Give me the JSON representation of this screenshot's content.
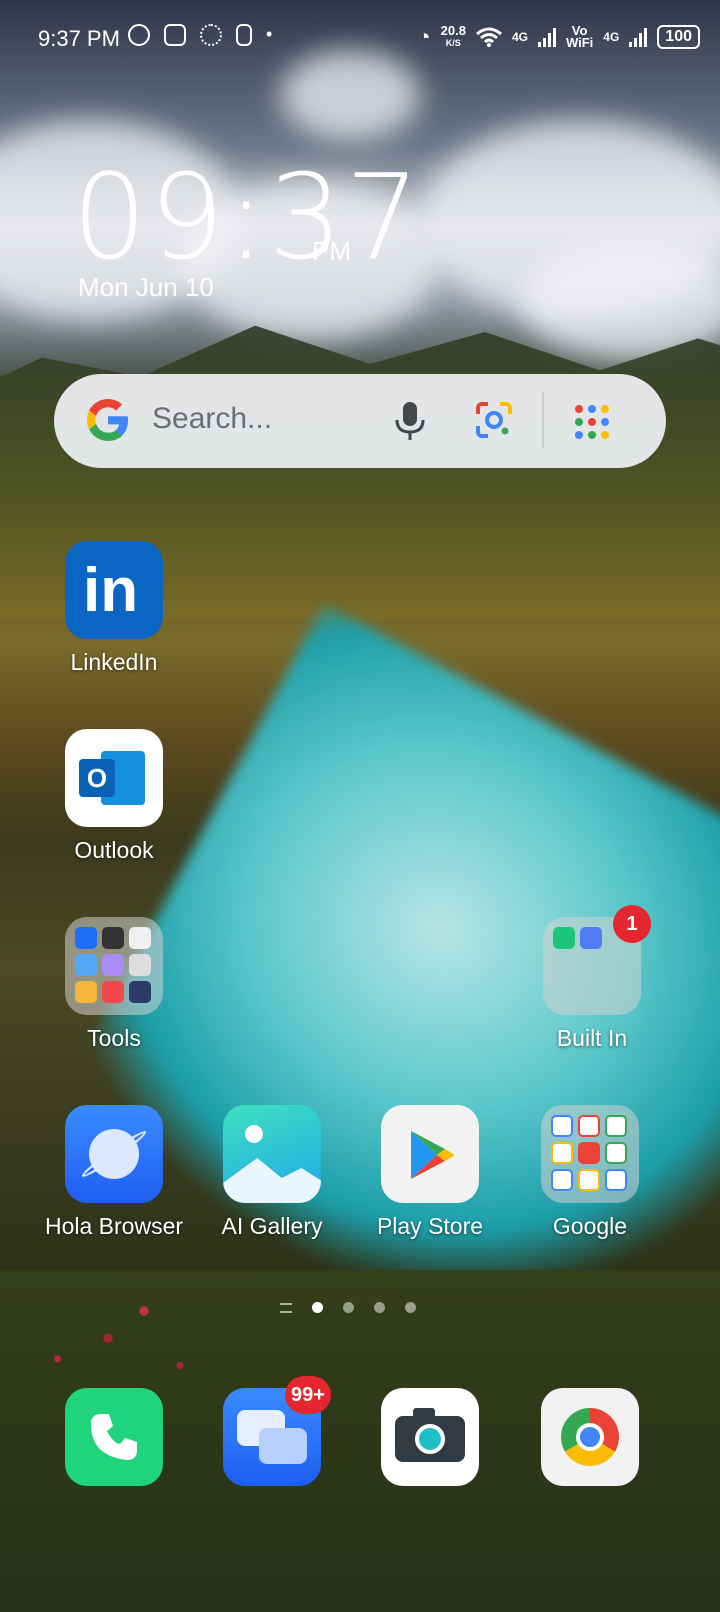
{
  "status_bar": {
    "time": "9:37 PM",
    "net_speed_value": "20.8",
    "net_speed_unit": "K/S",
    "net1": "4G",
    "vowifi_top": "Vo",
    "vowifi_bottom": "WiFi",
    "net2": "4G",
    "battery": "100"
  },
  "clock": {
    "time": "09:37",
    "ampm": "PM",
    "date": "Mon Jun 10"
  },
  "search": {
    "placeholder": "Search..."
  },
  "apps": {
    "linkedin": "LinkedIn",
    "outlook": "Outlook",
    "tools": "Tools",
    "builtin": "Built In",
    "builtin_badge": "1",
    "hola": "Hola Browser",
    "aigallery": "AI Gallery",
    "playstore": "Play Store",
    "google": "Google"
  },
  "dock": {
    "messages_badge": "99+"
  },
  "colors": {
    "linkedin": "#0a66c2",
    "badge": "#e4262f",
    "phone": "#1fd47a"
  }
}
